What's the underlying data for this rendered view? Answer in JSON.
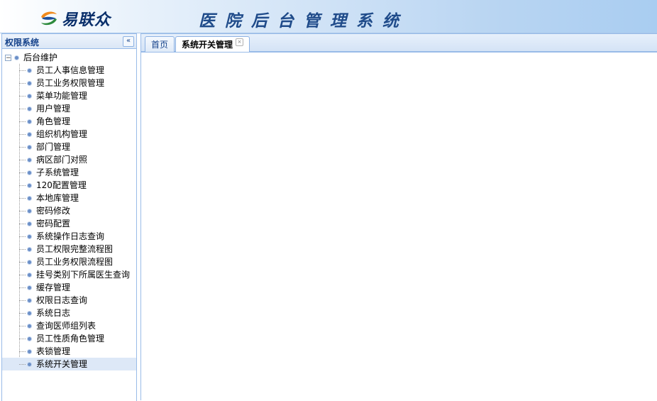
{
  "header": {
    "logo_text": "易联众",
    "system_title": "医院后台管理系统"
  },
  "left_panel": {
    "title": "权限系统",
    "collapse_symbol": "«",
    "tree": {
      "root_label": "后台维护",
      "toggle_symbol": "−",
      "items": [
        "员工人事信息管理",
        "员工业务权限管理",
        "菜单功能管理",
        "用户管理",
        "角色管理",
        "组织机构管理",
        "部门管理",
        "病区部门对照",
        "子系统管理",
        "120配置管理",
        "本地库管理",
        "密码修改",
        "密码配置",
        "系统操作日志查询",
        "员工权限完整流程图",
        "员工业务权限流程图",
        "挂号类别下所属医生查询",
        "缓存管理",
        "权限日志查询",
        "系统日志",
        "查询医师组列表",
        "员工性质角色管理",
        "表锁管理",
        "系统开关管理"
      ],
      "selected_item": "系统开关管理"
    }
  },
  "tabs": [
    {
      "label": "首页"
    },
    {
      "label": "系统开关管理",
      "close_symbol": "×"
    }
  ],
  "colors": {
    "accent": "#15428b",
    "border": "#99bbe8",
    "selected_bg": "#dde8f7"
  }
}
